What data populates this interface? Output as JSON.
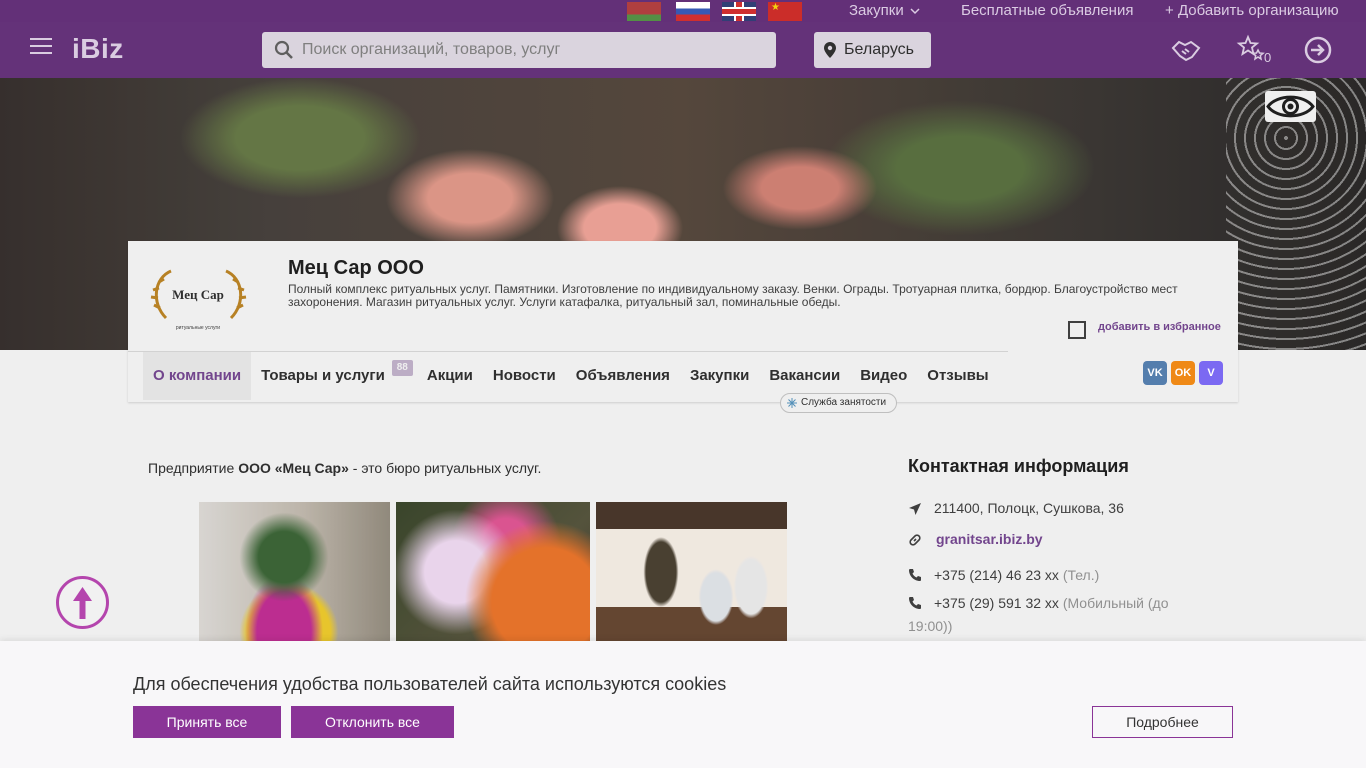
{
  "topbar": {
    "flags": [
      {
        "name": "flag-belarus-icon"
      },
      {
        "name": "flag-russia-icon"
      },
      {
        "name": "flag-uk-icon"
      },
      {
        "name": "flag-china-icon"
      }
    ],
    "purchases_label": "Закупки",
    "free_ads_label": "Бесплатные объявления",
    "add_org_label": "Добавить организацию",
    "add_icon": "+"
  },
  "header": {
    "logo": "iBiz",
    "search_placeholder": "Поиск организаций, товаров, услуг",
    "region": "Беларусь",
    "favorites_count": "0"
  },
  "company": {
    "name": "Мец Сар ООО",
    "logo_text": "Мец Сар",
    "logo_subtext": "ритуальные услуги",
    "description": "Полный комплекс ритуальных услуг. Памятники. Изготовление по индивидуальному заказу. Венки. Ограды. Тротуарная плитка, бордюр. Благоустройство мест захоронения. Магазин ритуальных услуг. Услуги катафалка, ритуальный зал, поминальные обеды.",
    "add_favorite_label": "добавить в избранное"
  },
  "tabs": [
    {
      "label": "О компании",
      "active": true
    },
    {
      "label": "Товары и услуги",
      "badge": "88"
    },
    {
      "label": "Акции"
    },
    {
      "label": "Новости"
    },
    {
      "label": "Объявления"
    },
    {
      "label": "Закупки"
    },
    {
      "label": "Вакансии"
    },
    {
      "label": "Видео"
    },
    {
      "label": "Отзывы"
    }
  ],
  "social": {
    "vk": "VK",
    "ok": "OK",
    "viber": "V"
  },
  "employment_service": "Служба занятости",
  "about": {
    "intro_prefix": "Предприятие ",
    "intro_company": "ООО «Мец Сар»",
    "intro_suffix": " - это бюро ритуальных услуг."
  },
  "contacts": {
    "title": "Контактная информация",
    "address": "211400, Полоцк, Сушкова, 36",
    "website": "granitsar.ibiz.by",
    "phone1": "+375 (214) 46 23 xx",
    "phone1_type": "(Тел.)",
    "phone2": "+375 (29) 591 32 xx",
    "phone2_type": "(Мобильный (до",
    "phone2_type_cont": "19:00))"
  },
  "cookie": {
    "message": "Для обеспечения удобства пользователей сайта используются cookies",
    "accept_label": "Принять все",
    "reject_label": "Отклонить все",
    "more_label": "Подробнее"
  },
  "colors": {
    "brand": "#5b2671",
    "accent": "#8a3497",
    "link": "#6a3a86"
  }
}
